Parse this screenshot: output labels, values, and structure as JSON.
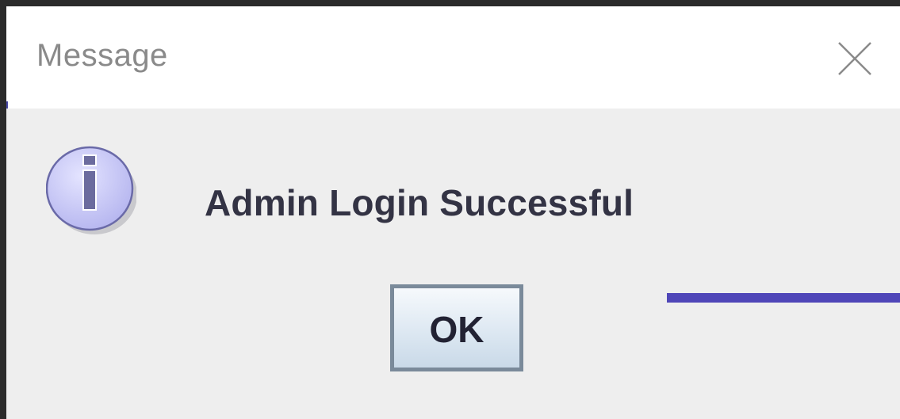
{
  "dialog": {
    "title": "Message",
    "message": "Admin Login Successful",
    "ok_label": "OK"
  },
  "icons": {
    "info": "info-icon",
    "close": "close-icon"
  },
  "colors": {
    "titlebar_bg": "#ffffff",
    "content_bg": "#eeeeee",
    "icon_fill": "#c8c8f4",
    "icon_stroke": "#5a5a9a",
    "accent_line": "#4f46b8"
  }
}
